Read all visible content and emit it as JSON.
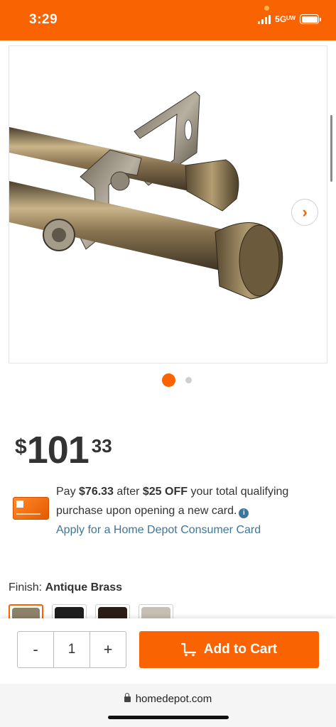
{
  "status_bar": {
    "time": "3:29",
    "network": "5Gᵁᵂ",
    "bg_color": "#f96302"
  },
  "gallery": {
    "active_index": 0,
    "total_images": 2,
    "next_icon": "chevron-right-icon"
  },
  "price": {
    "currency": "$",
    "dollars": "101",
    "cents": "33"
  },
  "promo": {
    "line_pay": "Pay ",
    "pay_amount": "$76.33",
    "line_after": " after ",
    "discount": "$25 OFF",
    "line_rest": " your total qualifying purchase upon opening a new card.",
    "apply_link": "Apply for a Home Depot Consumer Card",
    "info_icon": "info-icon"
  },
  "finish": {
    "label": "Finish: ",
    "selected": "Antique Brass",
    "swatches": [
      {
        "name": "Antique Brass",
        "color": "#8c8268",
        "selected": true
      },
      {
        "name": "Black",
        "color": "#1e1e1e",
        "selected": false
      },
      {
        "name": "Cocoa",
        "color": "#2a1c17",
        "selected": false
      },
      {
        "name": "Satin Nickel",
        "color": "#c6c0b4",
        "selected": false
      }
    ]
  },
  "cart": {
    "minus": "-",
    "quantity": "1",
    "plus": "+",
    "add_to_cart": "Add to Cart",
    "accent": "#f96302"
  },
  "browser": {
    "url": "homedepot.com"
  }
}
